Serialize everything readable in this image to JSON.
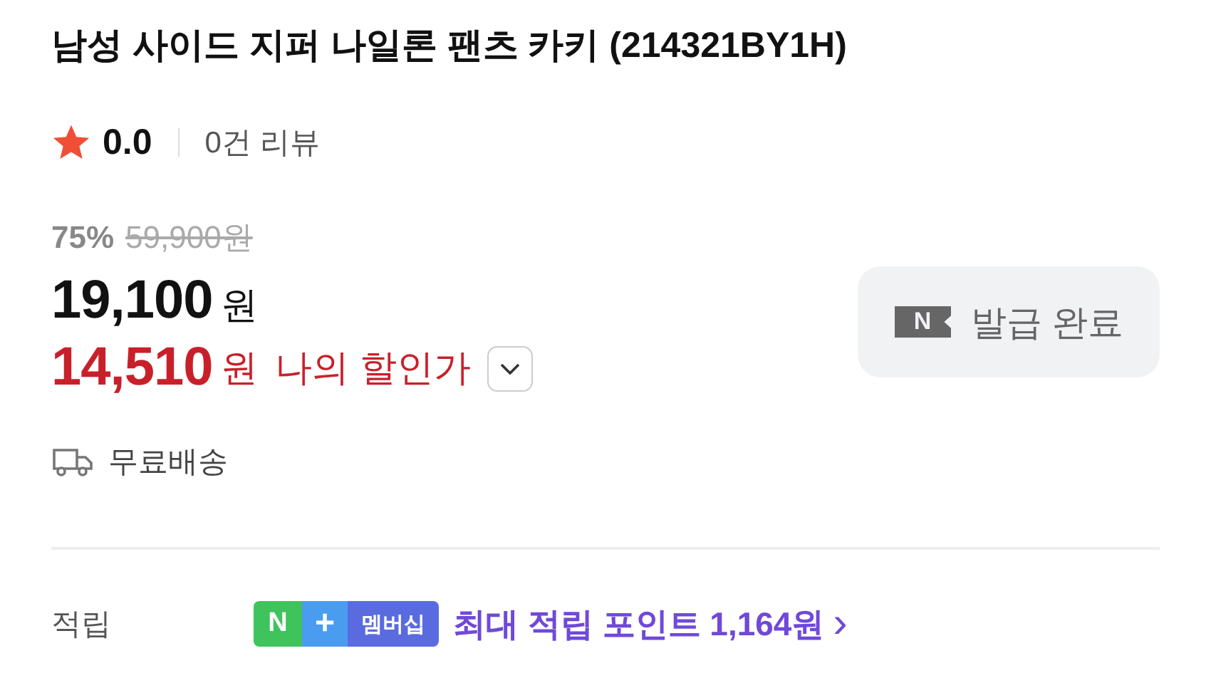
{
  "title": "남성 사이드 지퍼 나일론 팬츠 카키 (214321BY1H)",
  "rating": {
    "score": "0.0",
    "reviews": "0건 리뷰"
  },
  "price": {
    "discount": "75%",
    "original": "59,900원",
    "sale": "19,100",
    "sale_unit": "원",
    "my_price": "14,510",
    "my_unit": "원",
    "my_label": "나의 할인가",
    "expanded": false
  },
  "coupon_button": {
    "icon_text": "N",
    "label": "발급 완료",
    "disabled": true
  },
  "shipping": "무료배송",
  "points": {
    "label": "적립",
    "badge": [
      "N",
      "+",
      "멤버십"
    ],
    "text": "최대 적립 포인트 1,164원",
    "arrow": "›"
  }
}
